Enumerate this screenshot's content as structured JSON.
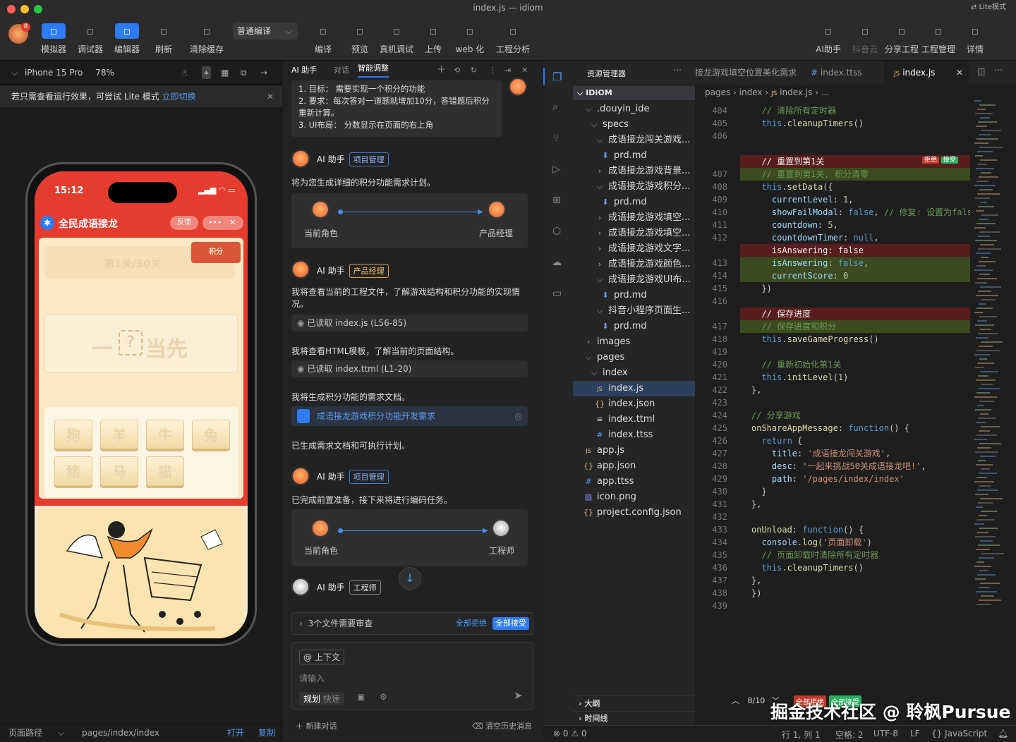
{
  "window": {
    "title": "index.js — idiom",
    "lite_badge": "Lite模式"
  },
  "toolbar": {
    "left": [
      {
        "label": "模拟器",
        "icon": "phone-icon",
        "active": true
      },
      {
        "label": "调试器",
        "icon": "sliders-icon",
        "active": false
      },
      {
        "label": "编辑器",
        "icon": "code-icon",
        "active": true
      },
      {
        "label": "刷新",
        "icon": "refresh-icon",
        "active": false
      },
      {
        "label": "清除缓存",
        "icon": "clear-cache-icon",
        "active": false
      }
    ],
    "compile_mode": "普通编译",
    "mid": [
      {
        "label": "编译"
      },
      {
        "label": "预览"
      },
      {
        "label": "真机调试"
      },
      {
        "label": "上传"
      },
      {
        "label": "web 化"
      },
      {
        "label": "工程分析"
      }
    ],
    "right": [
      {
        "label": "AI助手",
        "dim": false
      },
      {
        "label": "抖音云",
        "dim": true
      },
      {
        "label": "分享工程",
        "dim": false
      },
      {
        "label": "工程管理",
        "dim": false
      },
      {
        "label": "详情",
        "dim": false
      }
    ],
    "avatar_badge": "8"
  },
  "simulator": {
    "device": "iPhone 15 Pro",
    "zoom": "78%",
    "notice": "若只需查看运行效果，可尝试 Lite 模式",
    "notice_link": "立即切换",
    "time": "15:12",
    "app_title": "全民成语接龙",
    "feedback": "反馈",
    "level": "第1关/50关",
    "score_badge": "积分",
    "puzzle": {
      "left": "一",
      "mark": "?",
      "right": "当先"
    },
    "tiles": [
      "狗",
      "羊",
      "牛",
      "兔",
      "猪",
      "马",
      "猫"
    ],
    "path_label": "页面路径",
    "path": "pages/index/index",
    "open": "打开",
    "copy": "复制"
  },
  "ai_panel": {
    "tabs": [
      "AI 助手",
      "对话",
      "智能调整"
    ],
    "requirements": [
      "1. 目标： 需要实现一个积分的功能",
      "2. 要求：每次答对一道题就增加10分，答错题后积分重新计算。",
      "3. UI布局： 分数显示在页面的右上角"
    ],
    "assistant": "AI 助手",
    "msg1": {
      "tag": "项目管理",
      "text": "将为您生成详细的积分功能需求计划。",
      "from": "当前角色",
      "to": "产品经理"
    },
    "msg2": {
      "tag": "产品经理",
      "text": "我将查看当前的工程文件，了解游戏结构和积分功能的实现情况。",
      "read1": "已读取 index.js (L56-85)",
      "text2": "我将查看HTML模板，了解当前的页面结构。",
      "read2": "已读取 index.ttml (L1-20)",
      "text3": "我将生成积分功能的需求文档。",
      "doc": "成语接龙游戏积分功能开发需求",
      "text4": "已生成需求文档和可执行计划。"
    },
    "msg3": {
      "tag": "项目管理",
      "text": "已完成前置准备，接下来将进行编码任务。",
      "from": "当前角色",
      "to": "工程师"
    },
    "msg4": {
      "tag": "工程师"
    },
    "review": {
      "text": "3个文件需要审查",
      "reject_all": "全部拒绝",
      "accept_all": "全部接受"
    },
    "input": {
      "context": "@ 上下文",
      "placeholder": "请输入",
      "mode1": "规划",
      "mode2": "快速"
    },
    "footer": {
      "new_chat": "新建对话",
      "clear": "清空历史消息"
    }
  },
  "explorer": {
    "title": "资源管理器",
    "root": "IDIOM",
    "tree": [
      {
        "label": ".douyin_ide",
        "depth": 1,
        "type": "folder-open"
      },
      {
        "label": "specs",
        "depth": 2,
        "type": "folder-open"
      },
      {
        "label": "成语接龙闯关游戏...",
        "depth": 3,
        "type": "folder-open"
      },
      {
        "label": "prd.md",
        "depth": 4,
        "type": "md"
      },
      {
        "label": "成语接龙游戏背景...",
        "depth": 3,
        "type": "folder"
      },
      {
        "label": "成语接龙游戏积分...",
        "depth": 3,
        "type": "folder-open"
      },
      {
        "label": "prd.md",
        "depth": 4,
        "type": "md"
      },
      {
        "label": "成语接龙游戏填空...",
        "depth": 3,
        "type": "folder"
      },
      {
        "label": "成语接龙游戏填空...",
        "depth": 3,
        "type": "folder"
      },
      {
        "label": "成语接龙游戏文字...",
        "depth": 3,
        "type": "folder"
      },
      {
        "label": "成语接龙游戏颜色...",
        "depth": 3,
        "type": "folder"
      },
      {
        "label": "成语接龙游戏UI布...",
        "depth": 3,
        "type": "folder-open"
      },
      {
        "label": "prd.md",
        "depth": 4,
        "type": "md"
      },
      {
        "label": "抖音小程序页面生...",
        "depth": 3,
        "type": "folder-open"
      },
      {
        "label": "prd.md",
        "depth": 4,
        "type": "md"
      },
      {
        "label": "images",
        "depth": 1,
        "type": "folder"
      },
      {
        "label": "pages",
        "depth": 1,
        "type": "folder-open"
      },
      {
        "label": "index",
        "depth": 2,
        "type": "folder-open"
      },
      {
        "label": "index.js",
        "depth": 3,
        "type": "js",
        "selected": true
      },
      {
        "label": "index.json",
        "depth": 3,
        "type": "json"
      },
      {
        "label": "index.ttml",
        "depth": 3,
        "type": "ttml"
      },
      {
        "label": "index.ttss",
        "depth": 3,
        "type": "css"
      },
      {
        "label": "app.js",
        "depth": 1,
        "type": "js"
      },
      {
        "label": "app.json",
        "depth": 1,
        "type": "json"
      },
      {
        "label": "app.ttss",
        "depth": 1,
        "type": "css"
      },
      {
        "label": "icon.png",
        "depth": 1,
        "type": "img"
      },
      {
        "label": "project.config.json",
        "depth": 1,
        "type": "json"
      }
    ],
    "outline": "大纲",
    "timeline": "时间线"
  },
  "editor": {
    "tabs": [
      {
        "label": "成语接龙游戏填空位置美化需求",
        "active": false
      },
      {
        "label": "index.ttss",
        "active": false
      },
      {
        "label": "index.js",
        "active": true
      }
    ],
    "breadcrumb": [
      "pages",
      "index",
      "index.js",
      "..."
    ],
    "reject": "拒绝",
    "accept": "接受",
    "change_counter": "8/10",
    "bottom_reject": "全部拒绝",
    "bottom_accept": "全部接受",
    "lines": [
      {
        "n": "404",
        "bg": "",
        "parts": [
          [
            "cm",
            "  // 清除所有定时器"
          ]
        ]
      },
      {
        "n": "405",
        "bg": "",
        "parts": [
          [
            "kw",
            "  this"
          ],
          [
            "",
            "."
          ],
          [
            "fn",
            "cleanupTimers"
          ],
          [
            "",
            "()"
          ]
        ]
      },
      {
        "n": "406",
        "bg": "",
        "parts": []
      },
      {
        "n": "",
        "bg": "",
        "parts": []
      },
      {
        "n": "",
        "bg": "del",
        "parts": [
          [
            "",
            "  // 重置到第1关"
          ]
        ]
      },
      {
        "n": "407",
        "bg": "add",
        "parts": [
          [
            "cm",
            "  // 重置到第1关, 积分清零"
          ]
        ]
      },
      {
        "n": "408",
        "bg": "",
        "parts": [
          [
            "kw",
            "  this"
          ],
          [
            "",
            "."
          ],
          [
            "fn",
            "setData"
          ],
          [
            "",
            "({"
          ]
        ]
      },
      {
        "n": "409",
        "bg": "",
        "parts": [
          [
            "pr",
            "    currentLevel"
          ],
          [
            "",
            ": "
          ],
          [
            "nm",
            "1"
          ],
          [
            "",
            ","
          ]
        ]
      },
      {
        "n": "410",
        "bg": "",
        "parts": [
          [
            "pr",
            "    showFailModal"
          ],
          [
            "",
            ": "
          ],
          [
            "kw",
            "false"
          ],
          [
            "",
            ", "
          ],
          [
            "cm",
            "// 修复: 设置为false"
          ]
        ]
      },
      {
        "n": "411",
        "bg": "",
        "parts": [
          [
            "pr",
            "    countdown"
          ],
          [
            "",
            ": "
          ],
          [
            "nm",
            "5"
          ],
          [
            "",
            ","
          ]
        ]
      },
      {
        "n": "412",
        "bg": "",
        "parts": [
          [
            "pr",
            "    countdownTimer"
          ],
          [
            "",
            ": "
          ],
          [
            "kw",
            "null"
          ],
          [
            "",
            ","
          ]
        ]
      },
      {
        "n": "",
        "bg": "del",
        "parts": [
          [
            "",
            "    isAnswering: false"
          ]
        ]
      },
      {
        "n": "413",
        "bg": "add",
        "parts": [
          [
            "pr",
            "    isAnswering"
          ],
          [
            "",
            ": "
          ],
          [
            "kw",
            "false"
          ],
          [
            "",
            ","
          ]
        ]
      },
      {
        "n": "414",
        "bg": "add",
        "parts": [
          [
            "pr",
            "    currentScore"
          ],
          [
            "",
            ": "
          ],
          [
            "nm",
            "0"
          ]
        ]
      },
      {
        "n": "415",
        "bg": "",
        "parts": [
          [
            "",
            "  })"
          ]
        ]
      },
      {
        "n": "416",
        "bg": "",
        "parts": []
      },
      {
        "n": "",
        "bg": "del",
        "parts": [
          [
            "",
            "  // 保存进度"
          ]
        ]
      },
      {
        "n": "417",
        "bg": "add",
        "parts": [
          [
            "cm",
            "  // 保存进度和积分"
          ]
        ]
      },
      {
        "n": "418",
        "bg": "",
        "parts": [
          [
            "kw",
            "  this"
          ],
          [
            "",
            "."
          ],
          [
            "fn",
            "saveGameProgress"
          ],
          [
            "",
            "()"
          ]
        ]
      },
      {
        "n": "419",
        "bg": "",
        "parts": []
      },
      {
        "n": "420",
        "bg": "",
        "parts": [
          [
            "cm",
            "  // 重新初始化第1关"
          ]
        ]
      },
      {
        "n": "421",
        "bg": "",
        "parts": [
          [
            "kw",
            "  this"
          ],
          [
            "",
            "."
          ],
          [
            "fn",
            "initLevel"
          ],
          [
            "",
            "("
          ],
          [
            "nm",
            "1"
          ],
          [
            "",
            ")"
          ]
        ]
      },
      {
        "n": "422",
        "bg": "",
        "parts": [
          [
            "",
            "},"
          ]
        ]
      },
      {
        "n": "423",
        "bg": "",
        "parts": []
      },
      {
        "n": "424",
        "bg": "",
        "parts": [
          [
            "cm",
            "// 分享游戏"
          ]
        ]
      },
      {
        "n": "425",
        "bg": "",
        "parts": [
          [
            "fn",
            "onShareAppMessage"
          ],
          [
            "",
            ": "
          ],
          [
            "kw",
            "function"
          ],
          [
            "",
            "() {"
          ]
        ]
      },
      {
        "n": "426",
        "bg": "",
        "parts": [
          [
            "kw",
            "  return"
          ],
          [
            "",
            " {"
          ]
        ]
      },
      {
        "n": "427",
        "bg": "",
        "parts": [
          [
            "pr",
            "    title"
          ],
          [
            "",
            ": "
          ],
          [
            "st",
            "'成语接龙闯关游戏'"
          ],
          [
            "",
            ","
          ]
        ]
      },
      {
        "n": "428",
        "bg": "",
        "parts": [
          [
            "pr",
            "    desc"
          ],
          [
            "",
            ": "
          ],
          [
            "st",
            "'一起来挑战50关成语接龙吧!'"
          ],
          [
            "",
            ","
          ]
        ]
      },
      {
        "n": "429",
        "bg": "",
        "parts": [
          [
            "pr",
            "    path"
          ],
          [
            "",
            ": "
          ],
          [
            "st",
            "'/pages/index/index'"
          ]
        ]
      },
      {
        "n": "430",
        "bg": "",
        "parts": [
          [
            "",
            "  }"
          ]
        ]
      },
      {
        "n": "431",
        "bg": "",
        "parts": [
          [
            "",
            "},"
          ]
        ]
      },
      {
        "n": "432",
        "bg": "",
        "parts": []
      },
      {
        "n": "433",
        "bg": "",
        "parts": [
          [
            "fn",
            "onUnload"
          ],
          [
            "",
            ": "
          ],
          [
            "kw",
            "function"
          ],
          [
            "",
            "() {"
          ]
        ]
      },
      {
        "n": "434",
        "bg": "",
        "parts": [
          [
            "pr",
            "  console"
          ],
          [
            "",
            "."
          ],
          [
            "fn",
            "log"
          ],
          [
            "",
            "("
          ],
          [
            "st",
            "'页面卸载'"
          ],
          [
            "",
            ")"
          ]
        ]
      },
      {
        "n": "435",
        "bg": "",
        "parts": [
          [
            "cm",
            "  // 页面卸载时清除所有定时器"
          ]
        ]
      },
      {
        "n": "436",
        "bg": "",
        "parts": [
          [
            "kw",
            "  this"
          ],
          [
            "",
            "."
          ],
          [
            "fn",
            "cleanupTimers"
          ],
          [
            "",
            "()"
          ]
        ]
      },
      {
        "n": "437",
        "bg": "",
        "parts": [
          [
            "",
            "},"
          ]
        ]
      },
      {
        "n": "438",
        "bg": "",
        "parts": [
          [
            "",
            "})"
          ]
        ]
      },
      {
        "n": "439",
        "bg": "",
        "parts": []
      }
    ]
  },
  "status": {
    "problems": "⊗ 0 ⚠ 0",
    "position": "行 1, 列 1",
    "spaces": "空格: 2",
    "encoding": "UTF-8",
    "eol": "LF",
    "lang": "JavaScript"
  },
  "watermark": "掘金技术社区 @ 聆枫Pursue",
  "colors": {
    "accent": "#2d7bf5",
    "phone_red": "#e53c2f",
    "add_bg": "#3b4a1f",
    "del_bg": "#5a1d1d"
  }
}
